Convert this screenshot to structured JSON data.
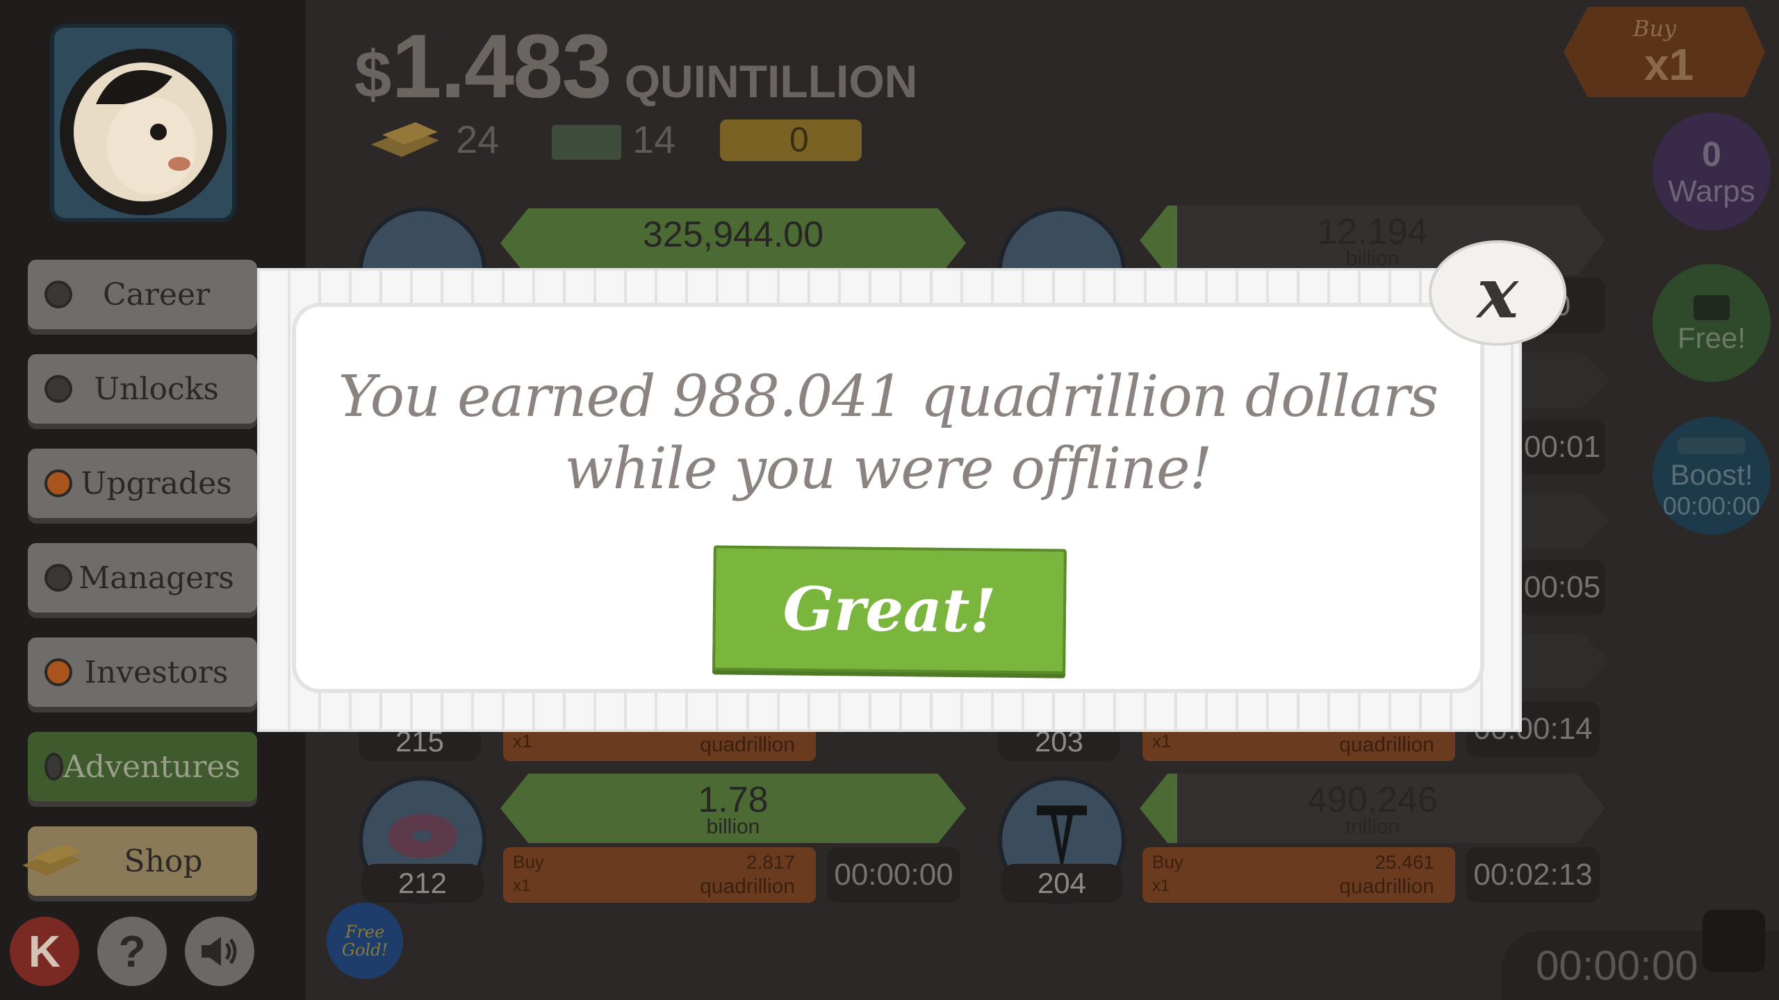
{
  "header": {
    "dollar_sign": "$",
    "money_amount": "1.483",
    "money_unit": "QUINTILLION",
    "gold_count": "24",
    "megabucks_count": "14",
    "ticket_count": "0"
  },
  "sidebar": {
    "items": [
      {
        "label": "Career"
      },
      {
        "label": "Unlocks"
      },
      {
        "label": "Upgrades"
      },
      {
        "label": "Managers"
      },
      {
        "label": "Investors"
      },
      {
        "label": "Adventures"
      },
      {
        "label": "Shop"
      }
    ],
    "k_label": "K",
    "help_label": "?",
    "free_gold_label": "Free Gold!"
  },
  "right_panel": {
    "buy_label": "Buy",
    "buy_mult": "x1",
    "warps_count": "0",
    "warps_label": "Warps",
    "free_label": "Free!",
    "boost_label": "Boost!",
    "boost_timer": "00:00:00",
    "bottom_timer": "00:00:00"
  },
  "businesses": {
    "row1_left": {
      "value": "325,944.00"
    },
    "row1_right": {
      "value": "12.194",
      "unit": "billion"
    },
    "row_hidden_left": {
      "count": "215",
      "buy_mult": "x1",
      "cost_unit": "quadrillion"
    },
    "row_hidden_right": {
      "count": "203",
      "buy_mult": "x1",
      "cost_unit": "quadrillion",
      "timer_partial": "00:00:14"
    },
    "partial_timers": [
      "0",
      "00:01",
      "00:05"
    ],
    "donut": {
      "count": "212",
      "value": "1.78",
      "unit": "billion",
      "buy_label": "Buy",
      "buy_mult": "x1",
      "cost": "2.817",
      "cost_unit": "quadrillion",
      "timer": "00:00:00"
    },
    "oil": {
      "count": "204",
      "value": "490.246",
      "unit": "trillion",
      "buy_label": "Buy",
      "buy_mult": "x1",
      "cost": "25.461",
      "cost_unit": "quadrillion",
      "timer": "00:02:13"
    }
  },
  "modal": {
    "message_line1": "You earned 988.041  quadrillion dollars",
    "message_line2": "while you were offline!",
    "button_label": "Great!",
    "close_label": "x"
  },
  "colors": {
    "accent_green": "#7ab53d",
    "modal_bg": "#ffffff",
    "text_gray": "#8a8380"
  }
}
